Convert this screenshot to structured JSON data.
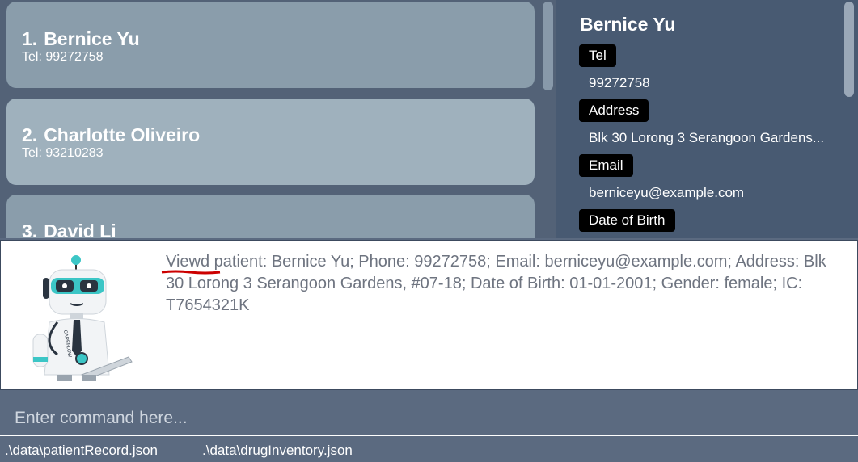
{
  "patient_list": {
    "items": [
      {
        "index": "1.",
        "name": "Bernice Yu",
        "tel": "Tel: 99272758",
        "color": "#8a9dab"
      },
      {
        "index": "2.",
        "name": "Charlotte Oliveiro",
        "tel": "Tel: 93210283",
        "color": "#9fb1bd"
      },
      {
        "index": "3.",
        "name": "David Li",
        "tel": "",
        "color": "#8a9dab"
      }
    ]
  },
  "detail": {
    "name": "Bernice Yu",
    "tel_label": "Tel",
    "tel_value": "99272758",
    "address_label": "Address",
    "address_value": "Blk 30 Lorong 3 Serangoon Gardens...",
    "email_label": "Email",
    "email_value": "berniceyu@example.com",
    "dob_label": "Date of Birth"
  },
  "result": {
    "text": "Viewd patient: Bernice Yu; Phone: 99272758; Email: berniceyu@example.com; Address: Blk 30 Lorong 3 Serangoon Gardens, #07-18; Date of Birth: 01-01-2001; Gender: female; IC: T7654321K",
    "mascot_name": "CAREFLOW"
  },
  "command": {
    "placeholder": "Enter command here..."
  },
  "status_bar": {
    "patient_file": ".\\data\\patientRecord.json",
    "drug_file": ".\\data\\drugInventory.json"
  },
  "colors": {
    "list_background": "#536277",
    "detail_background": "#485a72",
    "label_background": "#000000",
    "spellcheck_underline": "#cc0000"
  }
}
